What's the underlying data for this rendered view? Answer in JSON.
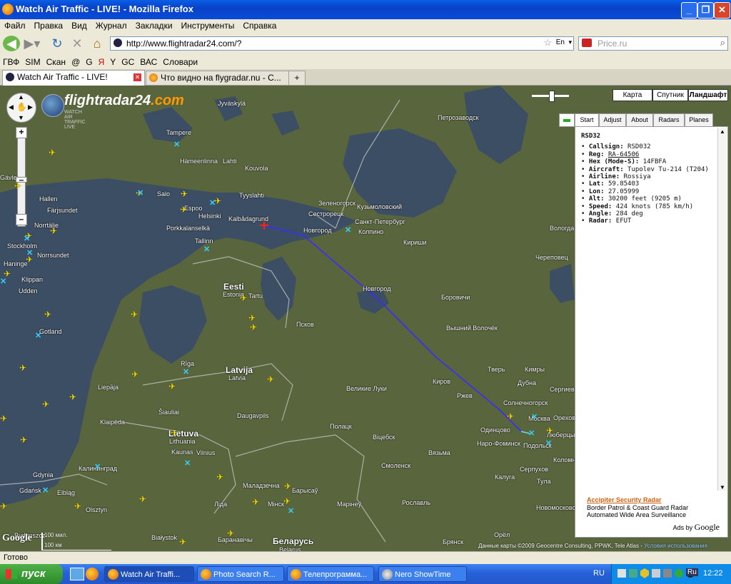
{
  "window": {
    "title": "Watch Air Traffic - LIVE! - Mozilla Firefox"
  },
  "menu": [
    "Файл",
    "Правка",
    "Вид",
    "Журнал",
    "Закладки",
    "Инструменты",
    "Справка"
  ],
  "nav": {
    "url": "http://www.flightradar24.com/?",
    "search_placeholder": "Price.ru",
    "lang": "En"
  },
  "bookmarks": [
    "ГВФ",
    "SIM",
    "Скан",
    "@",
    "G",
    "Я",
    "Y",
    "GC",
    "ВАС",
    "Словари"
  ],
  "tabs": [
    {
      "label": "Watch Air Traffic - LIVE!",
      "active": true
    },
    {
      "label": "Что видно на flygradar.nu - С...",
      "active": false
    }
  ],
  "map": {
    "logo_text": "flightradar24",
    "logo_domain": ".com",
    "logo_tagline": "WATCH AIR TRAFFIC LIVE",
    "map_types": [
      "Карта",
      "Спутник",
      "Ландшафт"
    ],
    "scale_top": "100 мил.",
    "scale_bottom": "100 км",
    "copyright": "Данные карты ©2009 Geocentre Consulting, PPWK, Tele Atlas -",
    "copyright_link": "Условия использования",
    "labels": {
      "jyvaskyla": "Jyväskylä",
      "tampere": "Tampere",
      "gavle": "Gävle",
      "hameenlinna": "Hämeenlinna",
      "lahti": "Lahti",
      "kouvola": "Kouvola",
      "hallen": "Hallen",
      "salo": "Salo",
      "espoo": "Espoo",
      "helsinki": "Helsinki",
      "tyyslahti": "Tyyslahti",
      "farjsundet": "Färjsundet",
      "porkkalanselka": "Porkkalanselkä",
      "kalbadagrund": "Kalbådagrund",
      "tallinn": "Tallinn",
      "norrtalje": "Norrtälje",
      "stockholm": "Stockholm",
      "norrsundet": "Norrsundet",
      "haninge": "Haninge",
      "klippan": "Klippan",
      "udden": "Udden",
      "gotland": "Gotland",
      "eesti": "Eesti",
      "estonia": "Estonia",
      "tartu": "Tartu",
      "pskov": "Псков",
      "riga": "Rīga",
      "latvija": "Latvija",
      "latvia": "Latvia",
      "liepaja": "Liepāja",
      "daugavpils": "Daugavpils",
      "siauliai": "Šiauliai",
      "lietuva": "Lietuva",
      "lithuania": "Lithuania",
      "kaunas": "Kaunas",
      "vilnius": "Vilnius",
      "klaipeda": "Klaipėda",
      "kaliningrad": "Калининград",
      "gdansk": "Gdańsk",
      "gdynia": "Gdynia",
      "elblag": "Elbląg",
      "olsztyn": "Olsztyn",
      "bialystok": "Białystok",
      "bydgoszcz": "Bydgoszcz",
      "belarus": "Беларусь",
      "belarus_en": "Belarus",
      "minsk": "Мінск",
      "baranavichy": "Баранавічы",
      "maladzechna": "Маладзечна",
      "lida": "Ліда",
      "polatsk": "Полацк",
      "vitsebsk": "Віцебск",
      "barysau": "Барысаў",
      "marine": "Марінеў",
      "spb": "Санкт-Петербург",
      "petrozavodsk": "Петрозаводск",
      "kirishi": "Кириши",
      "novgorod": "Новгород",
      "velikie_luki": "Великие Луки",
      "smolensk": "Смоленск",
      "vyazma": "Вязьма",
      "rzhev": "Ржев",
      "tver": "Тверь",
      "moskva": "Москва",
      "odintsovo": "Одинцово",
      "podolsk": "Подольск",
      "lyubertsy": "Люберцы",
      "kaluga": "Калуга",
      "tula": "Тула",
      "serpukhov": "Серпухов",
      "bryansk": "Брянск",
      "roslavl": "Рославль",
      "vyshny_volochek": "Вышний Волочёк",
      "borovichi": "Боровичи",
      "cherepovets": "Череповец",
      "dubna": "Дубна",
      "kimry": "Кимры",
      "vologda": "Вологда",
      "petrozavodsk2": "Петрозаводск",
      "kolpino": "Колпино",
      "kuzmolovsky": "Кузьмоловский",
      "zelenogorsk": "Зеленогорск",
      "sestroretsk": "Сестрорецк",
      "oryol": "Орёл",
      "novomoskovsk": "Новомосковск",
      "solnechnogorsk": "Солнечногорск",
      "kolomna": "Коломна",
      "sergiev": "Сергиев Посад",
      "orekhovo": "Орехово",
      "naro": "Наро-Фоминск",
      "kirov": "Киров",
      "pskov2": "Новгород"
    }
  },
  "panel": {
    "tabs": [
      "Start",
      "Adjust",
      "About",
      "Radars",
      "Planes"
    ],
    "active_tab": "Start",
    "callsign_header": "RSD32",
    "rows": [
      {
        "k": "Callsign:",
        "v": "RSD032"
      },
      {
        "k": "Reg:",
        "v": "RA-64506"
      },
      {
        "k": "Hex (Mode-S):",
        "v": "14FBFA"
      },
      {
        "k": "Aircraft:",
        "v": "Tupolev Tu-214 (T204)"
      },
      {
        "k": "Airline:",
        "v": "Rossiya"
      },
      {
        "k": "Lat:",
        "v": "59.85403"
      },
      {
        "k": "Lon:",
        "v": "27.05999"
      },
      {
        "k": "Alt:",
        "v": "30200 feet (9205 m)"
      },
      {
        "k": "Speed:",
        "v": "424 knots (785 km/h)"
      },
      {
        "k": "Angle:",
        "v": "284 deg"
      },
      {
        "k": "Radar:",
        "v": "EFUT"
      }
    ],
    "ads": {
      "title": "Accipiter Security Radar",
      "line1": "Border Patrol & Coast Guard Radar",
      "line2": "Automated Wide Area Surveillance",
      "ads_by": "Ads by",
      "google": "Google"
    }
  },
  "status": {
    "text": "Готово"
  },
  "taskbar": {
    "start": "пуск",
    "tasks": [
      "Watch Air Traffi...",
      "Photo Search R...",
      "Телепрограмма...",
      "Nero ShowTime"
    ],
    "lang": "RU",
    "lang_tray": "Ru",
    "clock": "12:22"
  },
  "colors": {
    "plane": "#ffe100",
    "radar": "#33d0ff",
    "route": "#3b2bff",
    "route_end": "#6be0e0",
    "water": "#3c4e63",
    "land": "#59663d"
  }
}
